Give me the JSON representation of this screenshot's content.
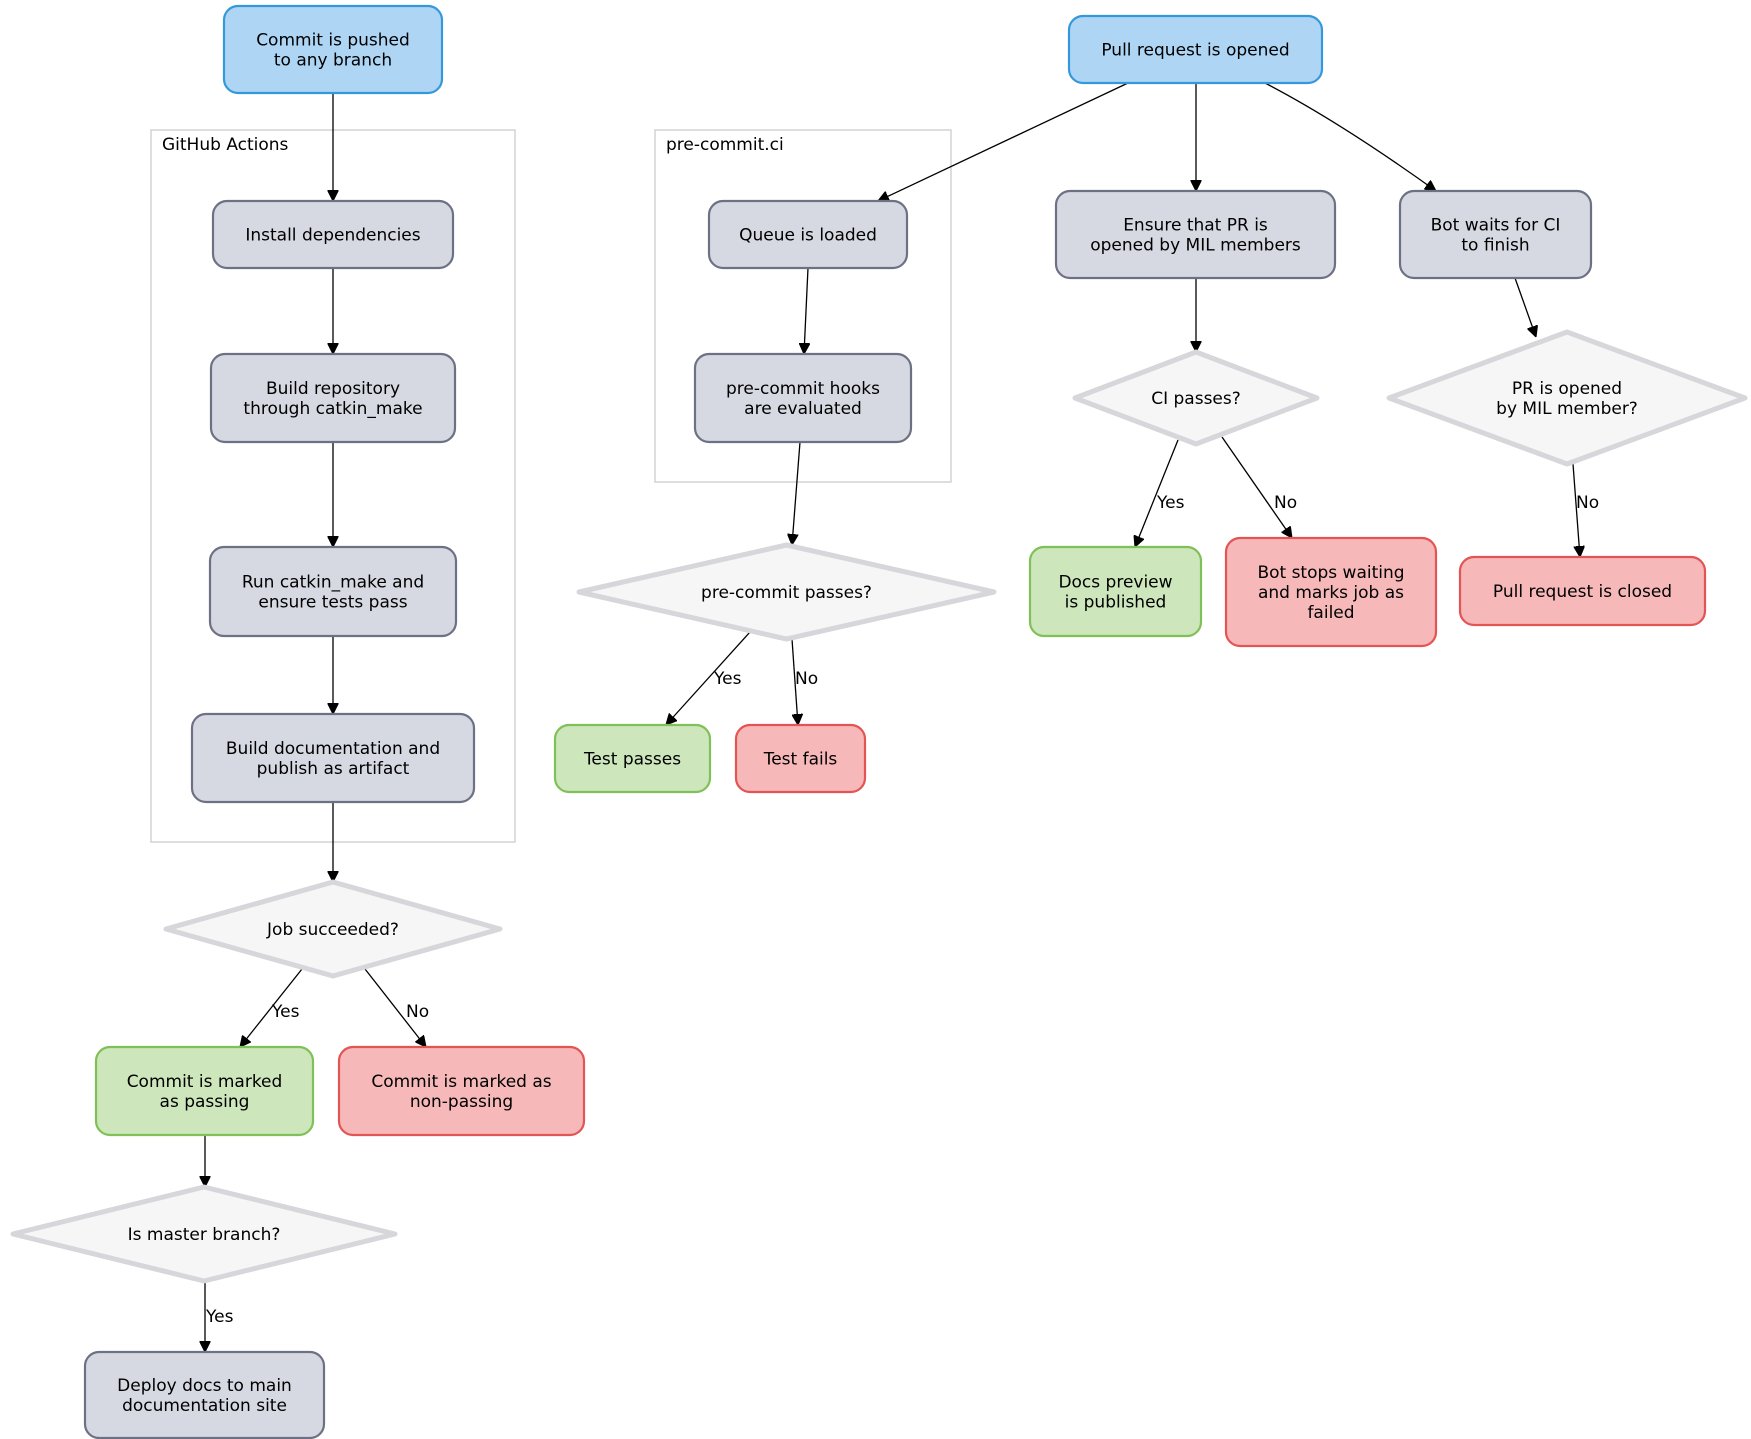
{
  "diagram": {
    "palette": {
      "start": {
        "fill": "#aed6f4",
        "stroke": "#3598db"
      },
      "process": {
        "fill": "#d7d9e2",
        "stroke": "#6d7184"
      },
      "decision": {
        "fill": "#f6f6f6",
        "stroke": "#d6d6db"
      },
      "success": {
        "fill": "#cde6bc",
        "stroke": "#80c058"
      },
      "failure": {
        "fill": "#f6b8b8",
        "stroke": "#e35454"
      }
    },
    "clusters": [
      {
        "id": "gha",
        "label": "GitHub Actions"
      },
      {
        "id": "pcc",
        "label": "pre-commit.ci"
      }
    ],
    "nodes": [
      {
        "id": "commit_pushed",
        "kind": "start",
        "lines": [
          "Commit is pushed",
          "to any branch"
        ]
      },
      {
        "id": "install_deps",
        "kind": "process",
        "cluster": "gha",
        "lines": [
          "Install dependencies"
        ]
      },
      {
        "id": "build_repo",
        "kind": "process",
        "cluster": "gha",
        "lines": [
          "Build repository",
          "through catkin_make"
        ]
      },
      {
        "id": "run_catkin",
        "kind": "process",
        "cluster": "gha",
        "lines": [
          "Run catkin_make and",
          "ensure tests pass"
        ]
      },
      {
        "id": "build_docs",
        "kind": "process",
        "cluster": "gha",
        "lines": [
          "Build documentation and",
          "publish as artifact"
        ]
      },
      {
        "id": "job_succeeded",
        "kind": "decision",
        "lines": [
          "Job succeeded?"
        ]
      },
      {
        "id": "commit_passing",
        "kind": "success",
        "lines": [
          "Commit is marked",
          "as passing"
        ]
      },
      {
        "id": "commit_nonpassing",
        "kind": "failure",
        "lines": [
          "Commit is marked as",
          "non-passing"
        ]
      },
      {
        "id": "is_master",
        "kind": "decision",
        "lines": [
          "Is master branch?"
        ]
      },
      {
        "id": "deploy_docs",
        "kind": "process",
        "lines": [
          "Deploy docs to main",
          "documentation site"
        ]
      },
      {
        "id": "pr_opened",
        "kind": "start",
        "lines": [
          "Pull request is opened"
        ]
      },
      {
        "id": "queue_loaded",
        "kind": "process",
        "cluster": "pcc",
        "lines": [
          "Queue is loaded"
        ]
      },
      {
        "id": "hooks_evaluated",
        "kind": "process",
        "cluster": "pcc",
        "lines": [
          "pre-commit hooks",
          "are evaluated"
        ]
      },
      {
        "id": "precommit_passes",
        "kind": "decision",
        "lines": [
          "pre-commit passes?"
        ]
      },
      {
        "id": "test_passes",
        "kind": "success",
        "lines": [
          "Test passes"
        ]
      },
      {
        "id": "test_fails",
        "kind": "failure",
        "lines": [
          "Test fails"
        ]
      },
      {
        "id": "ensure_pr",
        "kind": "process",
        "lines": [
          "Ensure that PR is",
          "opened by MIL members"
        ]
      },
      {
        "id": "bot_waits",
        "kind": "process",
        "lines": [
          "Bot waits for CI",
          "to finish"
        ]
      },
      {
        "id": "ci_passes",
        "kind": "decision",
        "lines": [
          "CI passes?"
        ]
      },
      {
        "id": "pr_mil_member",
        "kind": "decision",
        "lines": [
          "PR is opened",
          "by MIL member?"
        ]
      },
      {
        "id": "docs_preview",
        "kind": "success",
        "lines": [
          "Docs preview",
          "is published"
        ]
      },
      {
        "id": "bot_stops",
        "kind": "failure",
        "lines": [
          "Bot stops waiting",
          "and marks job as",
          "failed"
        ]
      },
      {
        "id": "pr_closed",
        "kind": "failure",
        "lines": [
          "Pull request is closed"
        ]
      }
    ],
    "edges": [
      {
        "from": "commit_pushed",
        "to": "install_deps",
        "label": ""
      },
      {
        "from": "install_deps",
        "to": "build_repo",
        "label": ""
      },
      {
        "from": "build_repo",
        "to": "run_catkin",
        "label": ""
      },
      {
        "from": "run_catkin",
        "to": "build_docs",
        "label": ""
      },
      {
        "from": "build_docs",
        "to": "job_succeeded",
        "label": ""
      },
      {
        "from": "job_succeeded",
        "to": "commit_passing",
        "label": "Yes"
      },
      {
        "from": "job_succeeded",
        "to": "commit_nonpassing",
        "label": "No"
      },
      {
        "from": "commit_passing",
        "to": "is_master",
        "label": ""
      },
      {
        "from": "is_master",
        "to": "deploy_docs",
        "label": "Yes"
      },
      {
        "from": "pr_opened",
        "to": "queue_loaded",
        "label": ""
      },
      {
        "from": "pr_opened",
        "to": "ensure_pr",
        "label": ""
      },
      {
        "from": "pr_opened",
        "to": "bot_waits",
        "label": ""
      },
      {
        "from": "queue_loaded",
        "to": "hooks_evaluated",
        "label": ""
      },
      {
        "from": "hooks_evaluated",
        "to": "precommit_passes",
        "label": ""
      },
      {
        "from": "precommit_passes",
        "to": "test_passes",
        "label": "Yes"
      },
      {
        "from": "precommit_passes",
        "to": "test_fails",
        "label": "No"
      },
      {
        "from": "ensure_pr",
        "to": "ci_passes",
        "label": ""
      },
      {
        "from": "ci_passes",
        "to": "docs_preview",
        "label": "Yes"
      },
      {
        "from": "ci_passes",
        "to": "bot_stops",
        "label": "No"
      },
      {
        "from": "bot_waits",
        "to": "pr_mil_member",
        "label": ""
      },
      {
        "from": "pr_mil_member",
        "to": "pr_closed",
        "label": "No"
      }
    ]
  }
}
